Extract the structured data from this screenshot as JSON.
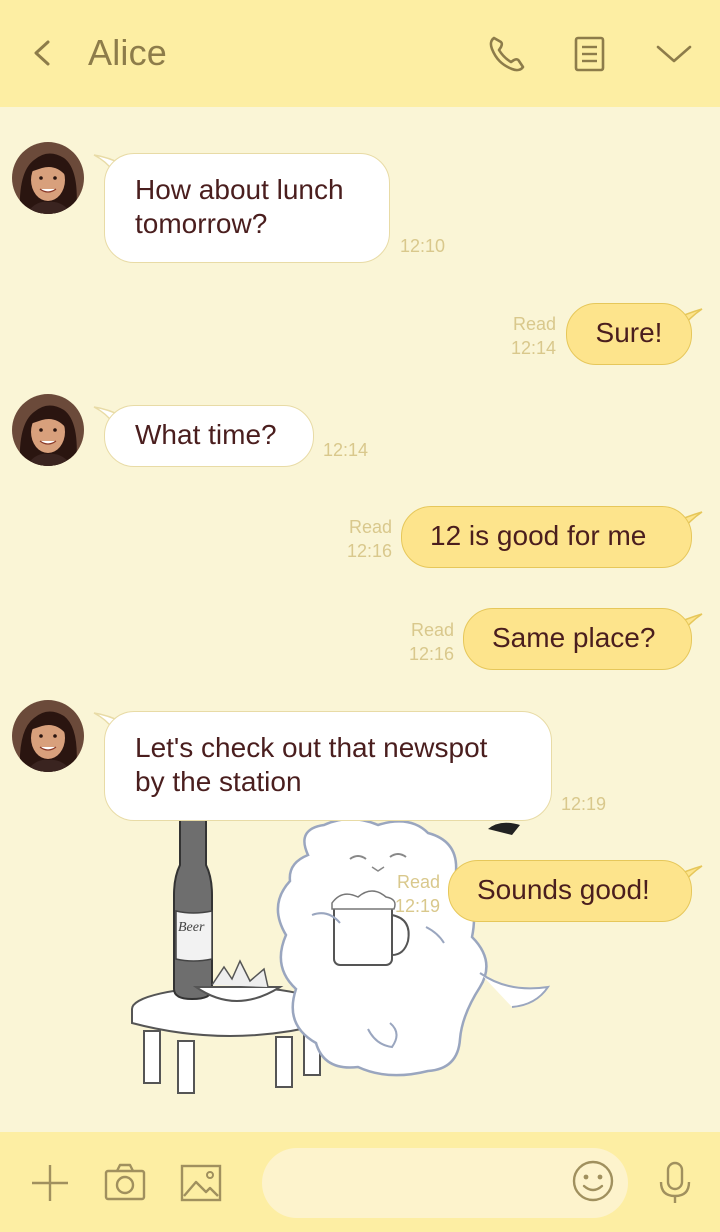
{
  "header": {
    "title": "Alice",
    "icons": [
      "back-arrow-icon",
      "phone-icon",
      "notes-icon",
      "chevron-down-icon"
    ]
  },
  "messages": [
    {
      "direction": "incoming",
      "text_lines": [
        "How about lunch",
        "tomorrow?"
      ],
      "time": "12:10"
    },
    {
      "direction": "outgoing",
      "text": "Sure!",
      "read": "Read",
      "time": "12:14"
    },
    {
      "direction": "incoming",
      "text": "What time?",
      "time": "12:14"
    },
    {
      "direction": "outgoing",
      "text": "12 is good for me",
      "read": "Read",
      "time": "12:16"
    },
    {
      "direction": "outgoing",
      "text": "Same place?",
      "read": "Read",
      "time": "12:16"
    },
    {
      "direction": "incoming",
      "text_lines": [
        "Let's check out that newspot",
        "by the station"
      ],
      "time": "12:19"
    },
    {
      "direction": "outgoing",
      "text": "Sounds good!",
      "read": "Read",
      "time": "12:19"
    }
  ],
  "sticker": {
    "bottle_label": "Beer"
  },
  "input_bar": {
    "icons": [
      "plus-icon",
      "camera-icon",
      "image-icon",
      "emoji-icon",
      "microphone-icon"
    ],
    "placeholder": ""
  },
  "colors": {
    "header_bg": "#fdeea3",
    "chat_bg": "#faf5d6",
    "outgoing_bubble": "#fde48c",
    "incoming_bubble": "#ffffff",
    "meta_text": "#d9c88c",
    "title_text": "#8d7c4a"
  }
}
